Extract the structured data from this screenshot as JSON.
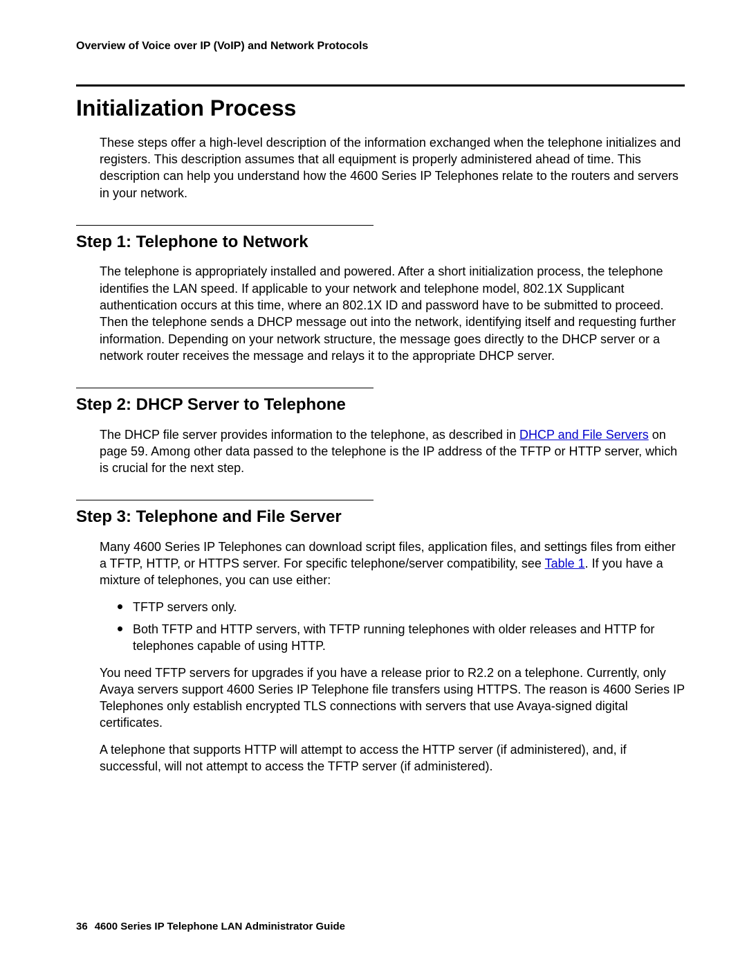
{
  "header": {
    "running_title": "Overview of Voice over IP (VoIP) and Network Protocols"
  },
  "section": {
    "title": "Initialization Process",
    "intro": "These steps offer a high-level description of the information exchanged when the telephone initializes and registers. This description assumes that all equipment is properly administered ahead of time. This description can help you understand how the 4600 Series IP Telephones relate to the routers and servers in your network."
  },
  "step1": {
    "title": "Step 1: Telephone to Network",
    "body": "The telephone is appropriately installed and powered. After a short initialization process, the telephone identifies the LAN speed. If applicable to your network and telephone model, 802.1X Supplicant authentication occurs at this time, where an 802.1X ID and password have to be submitted to proceed. Then the telephone sends a DHCP message out into the network, identifying itself and requesting further information. Depending on your network structure, the message goes directly to the DHCP server or a network router receives the message and relays it to the appropriate DHCP server."
  },
  "step2": {
    "title": "Step 2: DHCP Server to Telephone",
    "body_pre": "The DHCP file server provides information to the telephone, as described in ",
    "link1": "DHCP and File Servers",
    "body_post": " on page 59. Among other data passed to the telephone is the IP address of the TFTP or HTTP server, which is crucial for the next step."
  },
  "step3": {
    "title": "Step 3: Telephone and File Server",
    "body1_pre": "Many 4600 Series IP Telephones can download script files, application files, and settings files from either a TFTP, HTTP, or HTTPS server. For specific telephone/server compatibility, see ",
    "link_table": "Table 1",
    "body1_post": ". If you have a mixture of telephones, you can use either:",
    "bullets": [
      "TFTP servers only.",
      "Both TFTP and HTTP servers, with TFTP running telephones with older releases and HTTP for telephones capable of using HTTP."
    ],
    "body2": "You need TFTP servers for upgrades if you have a release prior to R2.2 on a telephone. Currently, only Avaya servers support 4600 Series IP Telephone file transfers using HTTPS. The reason is 4600 Series IP Telephones only establish encrypted TLS connections with servers that use Avaya-signed digital certificates.",
    "body3": "A telephone that supports HTTP will attempt to access the HTTP server (if administered), and, if successful, will not attempt to access the TFTP server (if administered)."
  },
  "footer": {
    "page": "36",
    "doc_title": "4600 Series IP Telephone LAN Administrator Guide"
  }
}
